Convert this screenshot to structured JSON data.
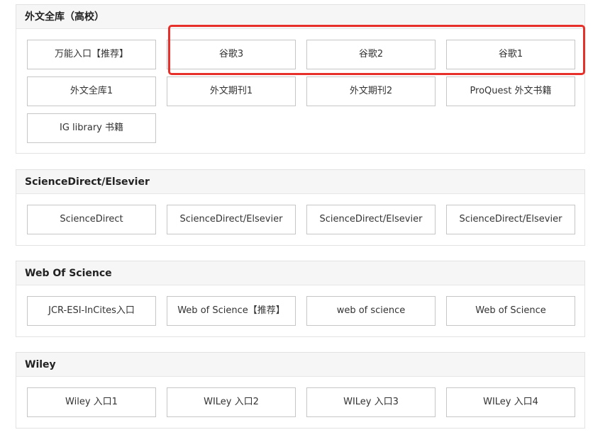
{
  "sections": [
    {
      "title": "外文全库（高校）",
      "buttons": [
        "万能入口【推荐】",
        "谷歌3",
        "谷歌2",
        "谷歌1",
        "外文全库1",
        "外文期刊1",
        "外文期刊2",
        "ProQuest 外文书籍",
        "IG library 书籍"
      ]
    },
    {
      "title": "ScienceDirect/Elsevier",
      "buttons": [
        "ScienceDirect",
        "ScienceDirect/Elsevier",
        "ScienceDirect/Elsevier",
        "ScienceDirect/Elsevier"
      ]
    },
    {
      "title": "Web Of Science",
      "buttons": [
        "JCR-ESI-InCites入口",
        "Web of Science【推荐】",
        "web of science",
        "Web of Science"
      ]
    },
    {
      "title": "Wiley",
      "buttons": [
        "Wiley 入口1",
        "WILey 入口2",
        "WILey 入口3",
        "WILey 入口4"
      ]
    }
  ],
  "annotation": {
    "color": "#e8302a"
  }
}
